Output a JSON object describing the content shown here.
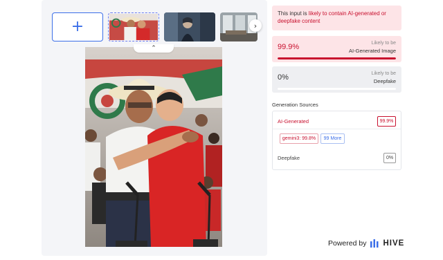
{
  "upload": {
    "add_icon": "plus-icon",
    "next_icon": "chevron-right-icon",
    "collapse_icon": "chevron-up-icon",
    "accent_color": "#3a6ee8"
  },
  "result": {
    "alert_prefix": "This input is ",
    "alert_highlight": "likely to contain AI-generated or deepfake content",
    "ai_generated": {
      "score_label": "99.9%",
      "score": 0.999,
      "caption_top": "Likely to be",
      "caption_bottom": "AI-Generated Image",
      "color": "#c8102e"
    },
    "deepfake": {
      "score_label": "0%",
      "score": 0.0,
      "caption_top": "Likely to be",
      "caption_bottom": "Deepfake"
    }
  },
  "generation_sources": {
    "title": "Generation Sources",
    "ai_label": "AI-Generated",
    "ai_value": "99.9%",
    "top_model": "gemini3: 99.8%",
    "more_label": "99 More",
    "deepfake_label": "Deepfake",
    "deepfake_value": "0%"
  },
  "footer": {
    "powered_by": "Powered by",
    "brand": "HIVE",
    "brand_icon": "hive-bars-icon"
  }
}
